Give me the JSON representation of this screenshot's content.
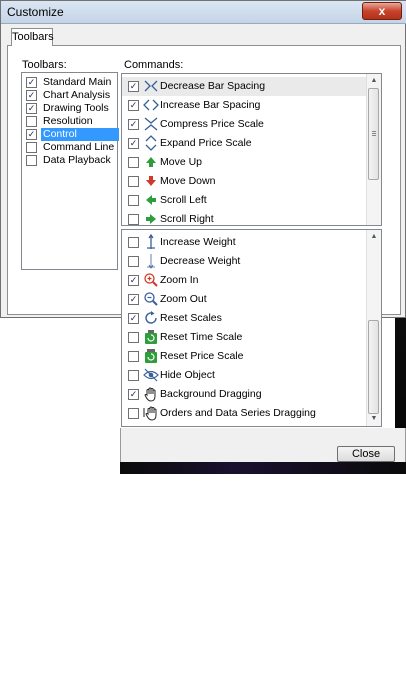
{
  "window": {
    "title": "Customize",
    "close_glyph": "x"
  },
  "tabs": [
    {
      "label": "Toolbars"
    }
  ],
  "toolbars": {
    "label": "Toolbars:",
    "items": [
      {
        "label": "Standard Main",
        "checked": true,
        "selected": false
      },
      {
        "label": "Chart Analysis",
        "checked": true,
        "selected": false
      },
      {
        "label": "Drawing Tools",
        "checked": true,
        "selected": false
      },
      {
        "label": "Resolution",
        "checked": false,
        "selected": false
      },
      {
        "label": "Control",
        "checked": true,
        "selected": true
      },
      {
        "label": "Command Line",
        "checked": false,
        "selected": false
      },
      {
        "label": "Data Playback",
        "checked": false,
        "selected": false
      }
    ]
  },
  "commands": {
    "label": "Commands:",
    "upper": [
      {
        "label": "Decrease Bar Spacing",
        "checked": true,
        "icon": "decrease-bar-spacing-icon"
      },
      {
        "label": "Increase Bar Spacing",
        "checked": true,
        "icon": "increase-bar-spacing-icon"
      },
      {
        "label": "Compress Price Scale",
        "checked": true,
        "icon": "compress-price-scale-icon"
      },
      {
        "label": "Expand Price Scale",
        "checked": true,
        "icon": "expand-price-scale-icon"
      },
      {
        "label": "Move Up",
        "checked": false,
        "icon": "arrow-up-icon"
      },
      {
        "label": "Move Down",
        "checked": false,
        "icon": "arrow-down-icon"
      },
      {
        "label": "Scroll Left",
        "checked": false,
        "icon": "scroll-left-icon"
      },
      {
        "label": "Scroll Right",
        "checked": false,
        "icon": "scroll-right-icon"
      }
    ],
    "lower": [
      {
        "label": "Increase Weight",
        "checked": false,
        "icon": "increase-weight-icon"
      },
      {
        "label": "Decrease Weight",
        "checked": false,
        "icon": "decrease-weight-icon"
      },
      {
        "label": "Zoom In",
        "checked": true,
        "icon": "zoom-in-icon"
      },
      {
        "label": "Zoom Out",
        "checked": true,
        "icon": "zoom-out-icon"
      },
      {
        "label": "Reset Scales",
        "checked": true,
        "icon": "reset-scales-icon"
      },
      {
        "label": "Reset Time Scale",
        "checked": false,
        "icon": "reset-time-scale-icon"
      },
      {
        "label": "Reset Price Scale",
        "checked": false,
        "icon": "reset-price-scale-icon"
      },
      {
        "label": "Hide Object",
        "checked": false,
        "icon": "hide-object-icon"
      },
      {
        "label": "Background Dragging",
        "checked": true,
        "icon": "hand-icon"
      },
      {
        "label": "Orders and Data Series Dragging",
        "checked": false,
        "icon": "hand-drag-icon"
      }
    ]
  },
  "buttons": {
    "close_label": "Close"
  },
  "scroll_glyphs": {
    "up": "▲",
    "down": "▼"
  },
  "colors": {
    "selection": "#3399ff",
    "icon_green": "#2e9e3a",
    "icon_red": "#d03a2a",
    "icon_blue": "#3a5f9a"
  }
}
